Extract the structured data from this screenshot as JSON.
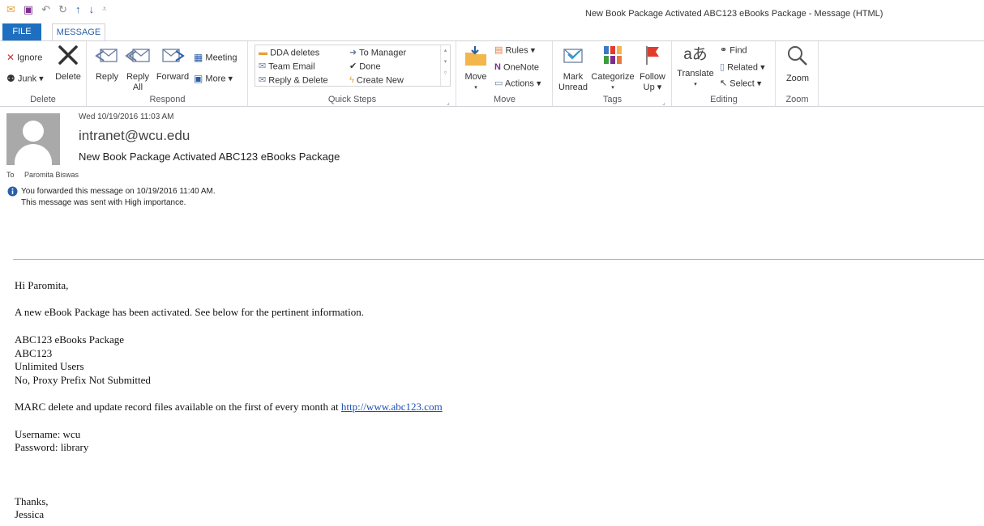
{
  "window_title": "New Book Package Activated ABC123 eBooks Package - Message (HTML)",
  "tabs": {
    "file": "FILE",
    "message": "MESSAGE"
  },
  "ribbon": {
    "delete_group": {
      "label": "Delete",
      "ignore": "Ignore",
      "junk": "Junk ▾",
      "delete": "Delete"
    },
    "respond_group": {
      "label": "Respond",
      "reply": "Reply",
      "reply_all_1": "Reply",
      "reply_all_2": "All",
      "forward": "Forward",
      "meeting": "Meeting",
      "more": "More ▾"
    },
    "quick_steps": {
      "label": "Quick Steps",
      "dda_deletes": "DDA deletes",
      "team_email": "Team Email",
      "reply_delete": "Reply & Delete",
      "to_manager": "To Manager",
      "done": "Done",
      "create_new": "Create New"
    },
    "move_group": {
      "label": "Move",
      "move": "Move",
      "rules": "Rules ▾",
      "onenote": "OneNote",
      "actions": "Actions ▾"
    },
    "tags_group": {
      "label": "Tags",
      "mark_unread_1": "Mark",
      "mark_unread_2": "Unread",
      "categorize": "Categorize",
      "follow_up_1": "Follow",
      "follow_up_2": "Up ▾"
    },
    "editing_group": {
      "label": "Editing",
      "translate": "Translate",
      "find": "Find",
      "related": "Related ▾",
      "select": "Select ▾"
    },
    "zoom_group": {
      "label": "Zoom",
      "zoom": "Zoom"
    }
  },
  "message": {
    "date": "Wed 10/19/2016 11:03 AM",
    "from": "intranet@wcu.edu",
    "subject": "New Book Package Activated ABC123 eBooks Package",
    "to_label": "To",
    "to": "Paromita Biswas",
    "info_forwarded": "You forwarded this message on 10/19/2016 11:40 AM.",
    "info_importance": "This message was sent with High importance."
  },
  "body": {
    "greeting": "Hi Paromita,",
    "intro": "A new eBook Package has been activated. See below for the pertinent information.",
    "package_name": "ABC123 eBooks Package",
    "package_code": "ABC123",
    "users": "Unlimited Users",
    "proxy": "No, Proxy Prefix Not Submitted",
    "marc_text": "MARC delete and update record files available on the first of every month at ",
    "marc_link": "http://www.abc123.com",
    "username": "Username: wcu",
    "password": "Password: library",
    "thanks": "Thanks,",
    "signature": "Jessica"
  },
  "colors": {
    "accent": "#1e6fbf",
    "divider": "#e8a93a",
    "link": "#1a4fb5",
    "flag": "#e23b2e"
  }
}
